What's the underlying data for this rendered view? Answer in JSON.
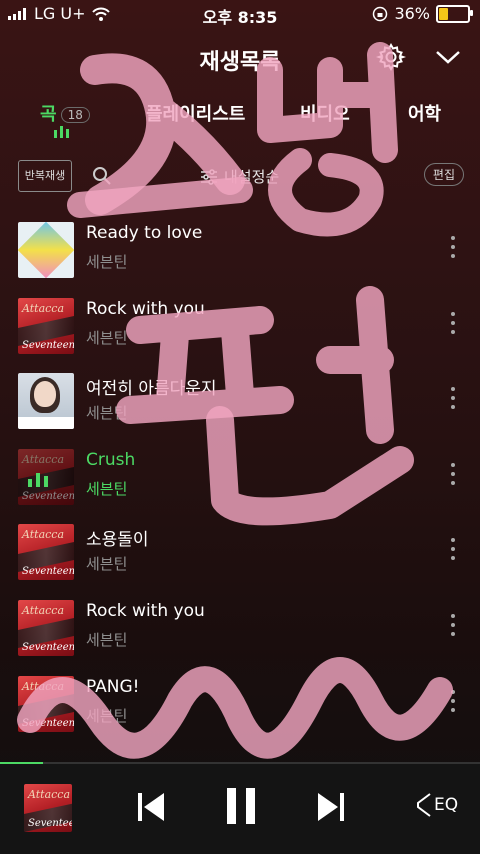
{
  "status_bar": {
    "carrier": "LG U+",
    "time": "오후 8:35",
    "battery": "36%",
    "battery_level": 0.36
  },
  "header": {
    "title": "재생목록",
    "settings_icon": "gear-icon",
    "collapse_icon": "chevron-down-icon"
  },
  "tabs": [
    {
      "label": "곡",
      "count": "18",
      "active": true
    },
    {
      "label": "플레이리스트"
    },
    {
      "label": "비디오"
    },
    {
      "label": "어학"
    }
  ],
  "toolbar": {
    "repeat_label": "반복재생",
    "search_icon": "search-icon",
    "sort_label": "내설정순",
    "edit_label": "편집"
  },
  "songs": [
    {
      "title": "Ready to love",
      "artist": "세븐틴",
      "art": "diamond",
      "playing": false
    },
    {
      "title": "Rock with you",
      "artist": "세븐틴",
      "art": "attacca",
      "playing": false
    },
    {
      "title": "여전히 아름다운지",
      "artist": "세븐틴",
      "art": "portrait",
      "playing": false
    },
    {
      "title": "Crush",
      "artist": "세븐틴",
      "art": "attacca",
      "playing": true
    },
    {
      "title": "소용돌이",
      "artist": "세븐틴",
      "art": "attacca",
      "playing": false
    },
    {
      "title": "Rock with you",
      "artist": "세븐틴",
      "art": "attacca",
      "playing": false
    },
    {
      "title": "PANG!",
      "artist": "세븐틴",
      "art": "attacca",
      "playing": false
    }
  ],
  "album_art_text": {
    "top": "Attacca",
    "bottom": "Seventeen"
  },
  "player": {
    "progress": 0.09,
    "prev_icon": "skip-previous-icon",
    "pause_icon": "pause-icon",
    "next_icon": "skip-next-icon",
    "eq_label": "EQ"
  },
  "colors": {
    "accent": "#4cd964",
    "scribble": "#f0a5c0"
  }
}
